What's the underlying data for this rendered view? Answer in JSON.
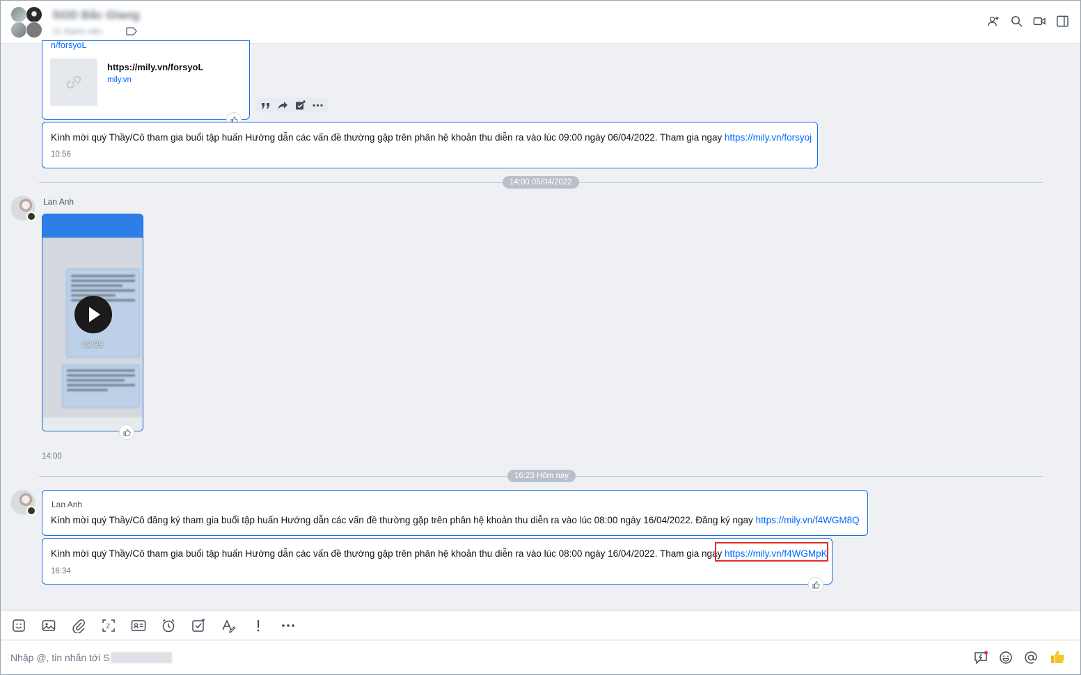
{
  "header": {
    "group_name": "SGD Bắc Giang",
    "group_sub": "21 thành viên",
    "icons": [
      "add-member-icon",
      "search-icon",
      "video-call-icon",
      "toggle-sidebar-icon"
    ]
  },
  "messages": {
    "link_preview": {
      "top_link_fragment": "n/forsyoL",
      "title": "https://mily.vn/forsyoL",
      "domain": "mily.vn"
    },
    "msg1": {
      "text": "Kính mời quý Thầy/Cô tham gia buổi tập huấn Hướng dẫn các vấn đề thường gặp trên phân hệ khoản thu diễn ra vào lúc 09:00 ngày 06/04/2022. Tham gia ngay ",
      "link": "https://mily.vn/forsyoj",
      "time": "10:56"
    },
    "separator1": "14:00 05/04/2022",
    "video_msg": {
      "sender": "Lan Anh",
      "duration": "02:39",
      "time": "14:00"
    },
    "separator2": "16:23 Hôm nay",
    "msg2": {
      "sender": "Lan Anh",
      "text": "Kính mời quý Thầy/Cô đăng ký tham gia buổi tập huấn Hướng dẫn các vấn đề thường gặp trên phân hệ khoản thu diễn ra vào lúc 08:00 ngày 16/04/2022.  Đăng ký ngay ",
      "link": "https://mily.vn/f4WGM8Q"
    },
    "msg3": {
      "text": "Kính mời quý Thầy/Cô tham gia buổi tập huấn Hướng dẫn các vấn đề thường gặp trên phân hệ khoản thu diễn ra vào lúc 08:00 ngày 16/04/2022. Tham gia ngay ",
      "link": "https://mily.vn/f4WGMpK",
      "time": "16:34"
    }
  },
  "hover_actions": [
    "quote-icon",
    "forward-icon",
    "add-task-icon",
    "more-icon"
  ],
  "toolbar": [
    "sticker-icon",
    "image-icon",
    "attach-icon",
    "screenshot-icon",
    "contact-card-icon",
    "reminder-icon",
    "task-icon",
    "format-icon",
    "urgent-icon",
    "more-icon"
  ],
  "composer": {
    "placeholder": "Nhập @, tin nhắn tới S",
    "icons": [
      "quick-message-icon",
      "emoji-icon",
      "mention-icon",
      "thumbs-up-icon"
    ]
  }
}
